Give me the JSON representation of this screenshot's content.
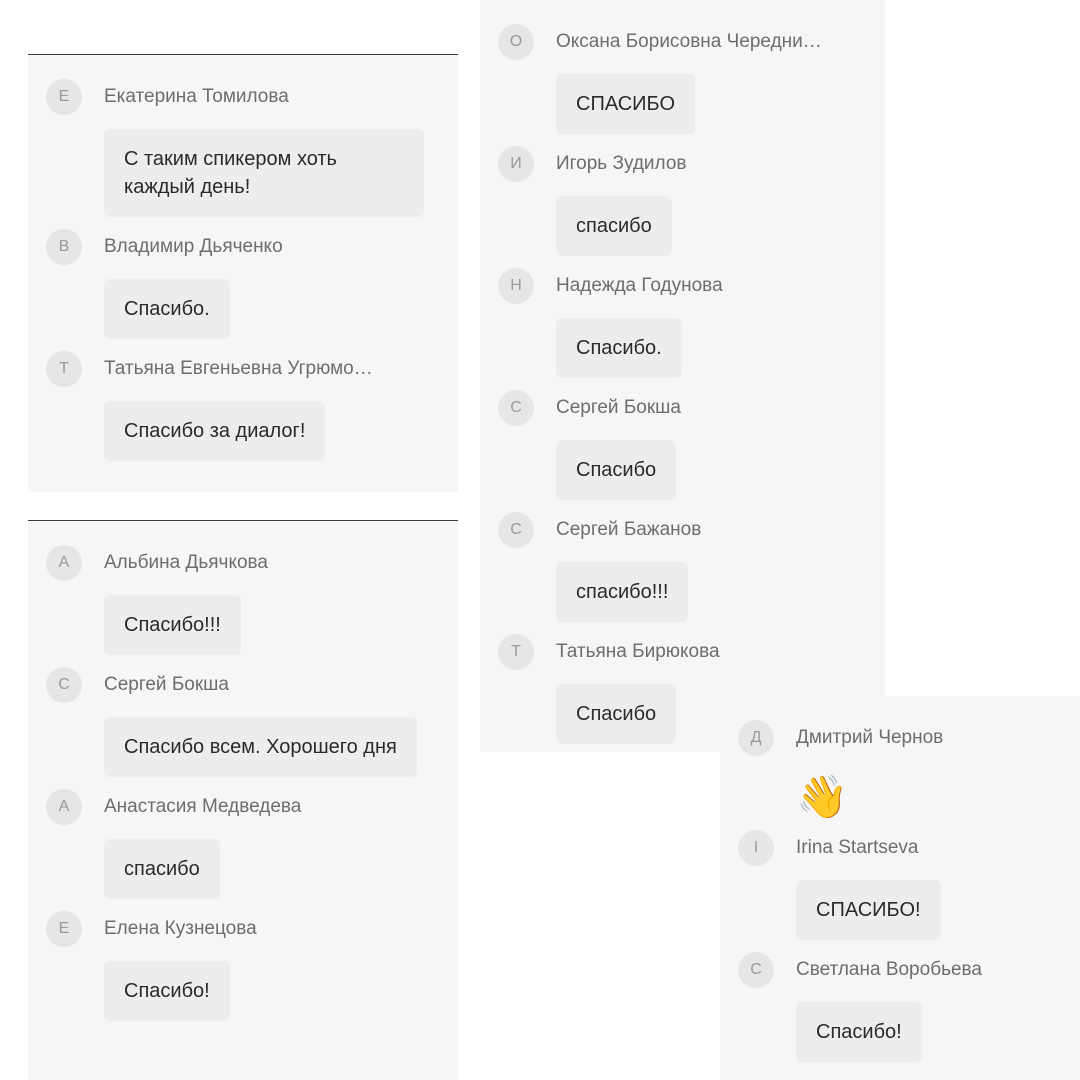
{
  "panel1": [
    {
      "initial": "Е",
      "author": "Екатерина Томилова",
      "text": "С таким спикером хоть каждый день!"
    },
    {
      "initial": "В",
      "author": "Владимир Дьяченко",
      "text": "Спасибо."
    },
    {
      "initial": "Т",
      "author": "Татьяна Евгеньевна Угрюмо…",
      "text": "Спасибо за диалог!"
    }
  ],
  "panel2": [
    {
      "initial": "А",
      "author": "Альбина Дьячкова",
      "text": "Спасибо!!!"
    },
    {
      "initial": "С",
      "author": "Сергей Бокша",
      "text": "Спасибо всем. Хорошего дня"
    },
    {
      "initial": "А",
      "author": "Анастасия Медведева",
      "text": "спасибо"
    },
    {
      "initial": "Е",
      "author": "Елена Кузнецова",
      "text": "Спасибо!"
    }
  ],
  "panel3": [
    {
      "initial": "О",
      "author": "Оксана Борисовна Чередни…",
      "text": "СПАСИБО"
    },
    {
      "initial": "И",
      "author": "Игорь Зудилов",
      "text": "спасибо"
    },
    {
      "initial": "Н",
      "author": "Надежда Годунова",
      "text": "Спасибо."
    },
    {
      "initial": "С",
      "author": "Сергей Бокша",
      "text": "Спасибо"
    },
    {
      "initial": "С",
      "author": "Сергей Бажанов",
      "text": "спасибо!!!"
    },
    {
      "initial": "Т",
      "author": "Татьяна Бирюкова",
      "text": "Спасибо"
    }
  ],
  "panel4": [
    {
      "initial": "Д",
      "author": "Дмитрий Чернов",
      "text": "👋",
      "plain": true
    },
    {
      "initial": "I",
      "author": "Irina Startseva",
      "text": "СПАСИБО!"
    },
    {
      "initial": "С",
      "author": "Светлана Воробьева",
      "text": "Спасибо!"
    }
  ]
}
